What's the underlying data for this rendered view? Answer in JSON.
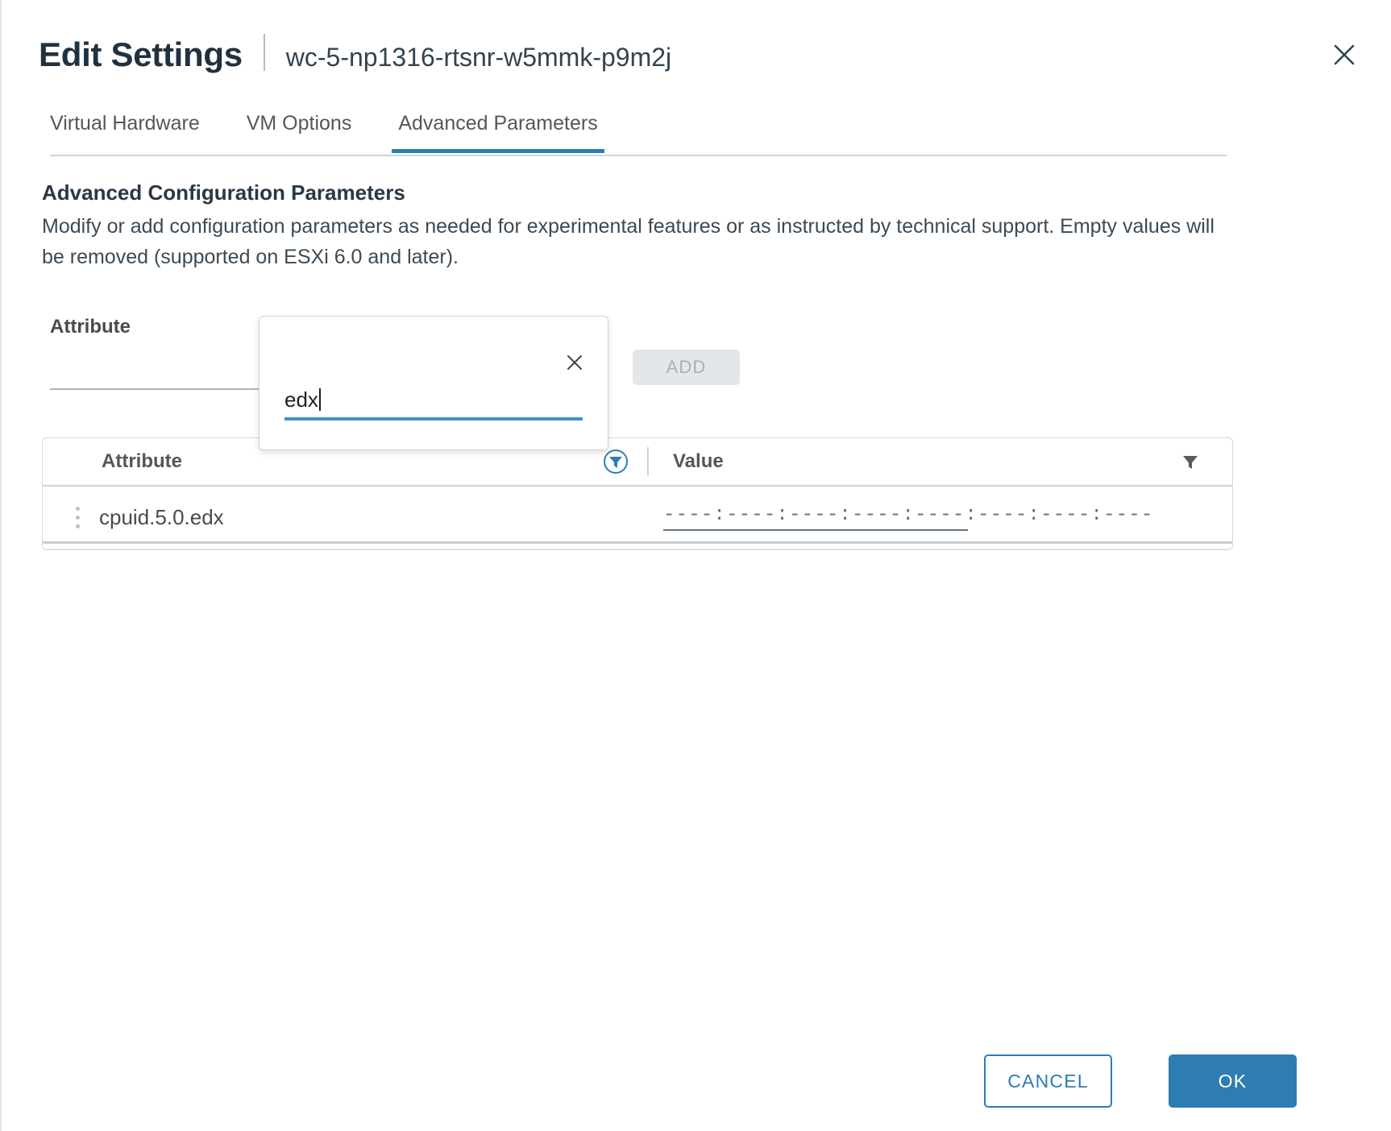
{
  "header": {
    "title": "Edit Settings",
    "subtitle": "wc-5-np1316-rtsnr-w5mmk-p9m2j",
    "close_icon": "close-icon"
  },
  "tabs": [
    {
      "label": "Virtual Hardware",
      "active": false
    },
    {
      "label": "VM Options",
      "active": false
    },
    {
      "label": "Advanced Parameters",
      "active": true
    }
  ],
  "section": {
    "title": "Advanced Configuration Parameters",
    "description": "Modify or add configuration parameters as needed for experimental features or as instructed by technical support. Empty values will be removed (supported on ESXi 6.0 and later)."
  },
  "form": {
    "attribute_label": "Attribute",
    "attribute_value": "",
    "add_button": "ADD",
    "add_button_disabled": true
  },
  "popup": {
    "input_value": "edx",
    "close_icon": "close-icon"
  },
  "table": {
    "columns": [
      {
        "label": "Attribute",
        "filter_icon": "filter-active-icon"
      },
      {
        "label": "Value",
        "filter_icon": "filter-icon"
      }
    ],
    "rows": [
      {
        "menu_icon": "kebab-menu-icon",
        "attribute": "cpuid.5.0.edx",
        "value": "----:----:----:----:----:----:----:----"
      }
    ]
  },
  "footer": {
    "cancel_label": "CANCEL",
    "ok_label": "OK"
  },
  "colors": {
    "accent": "#2e7cb2",
    "text": "#2b3744",
    "muted": "#565656",
    "disabled_bg": "#e3e7e9",
    "border": "#cdd5db"
  }
}
